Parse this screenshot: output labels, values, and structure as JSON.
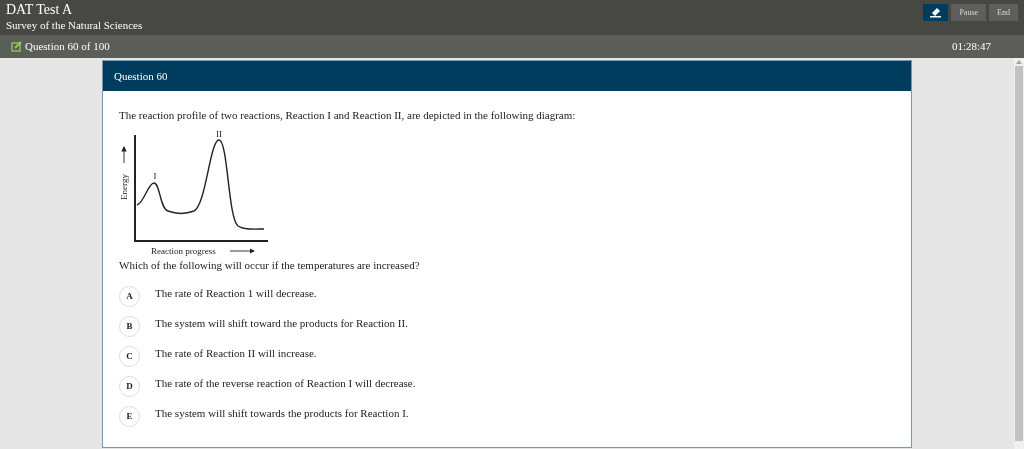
{
  "header": {
    "title": "DAT Test A",
    "subtitle": "Survey of the Natural Sciences",
    "buttons": [
      {
        "kind": "icon"
      },
      {
        "kind": "text",
        "label": "Pause"
      },
      {
        "kind": "text",
        "label": "End"
      }
    ]
  },
  "status_bar": {
    "progress": "Question 60 of 100",
    "timer": "01:28:47"
  },
  "question": {
    "heading": "Question 60",
    "stem": "The reaction profile of two reactions, Reaction I and Reaction II, are depicted in the following diagram:",
    "diagram": {
      "peak_1_label": "I",
      "peak_2_label": "II",
      "y_axis_label": "Energy",
      "x_axis_label": "Reaction progress"
    },
    "prompt": "Which of the following will occur if the temperatures are increased?",
    "options": [
      {
        "letter": "A",
        "text": "The rate of Reaction 1 will decrease.",
        "selected": false
      },
      {
        "letter": "B",
        "text": "The system will shift toward the products for Reaction II.",
        "selected": false
      },
      {
        "letter": "C",
        "text": "The rate of Reaction II will increase.",
        "selected": false
      },
      {
        "letter": "D",
        "text": "The rate of the reverse reaction of Reaction I will decrease.",
        "selected": false
      },
      {
        "letter": "E",
        "text": "The system will shift towards the products for Reaction I.",
        "selected": false
      }
    ]
  }
}
